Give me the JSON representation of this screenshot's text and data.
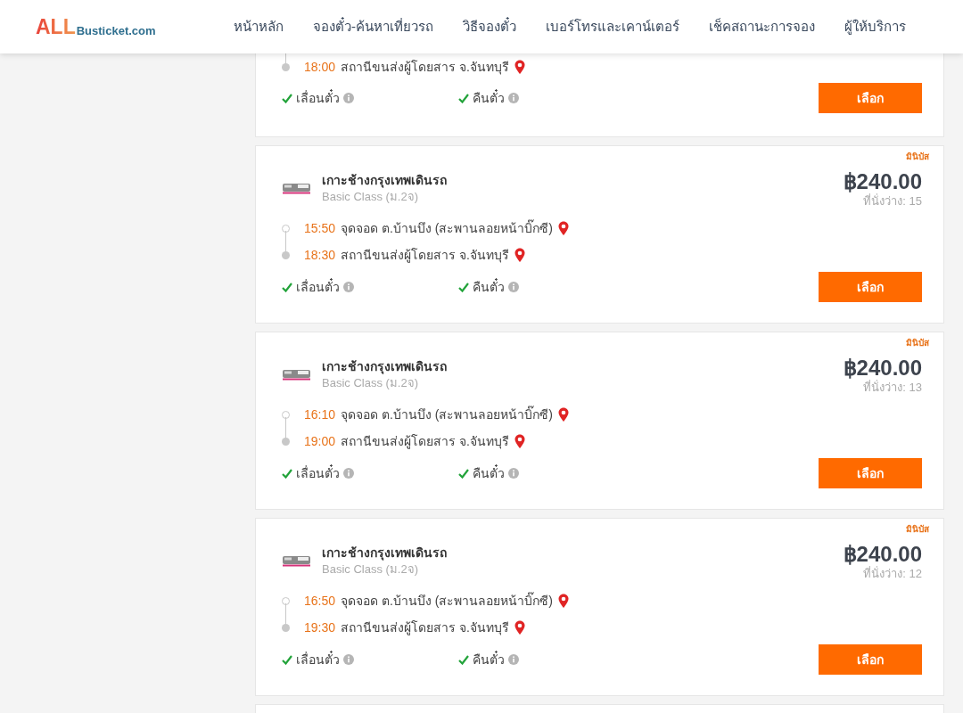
{
  "header": {
    "logo": {
      "mark": "ALL",
      "name": "Busticket.com"
    },
    "nav": [
      {
        "label": "หน้าหลัก"
      },
      {
        "label": "จองตั๋ว-ค้นหาเที่ยวรถ"
      },
      {
        "label": "วิธีจองตั๋ว"
      },
      {
        "label": "เบอร์โทรและเคาน์เตอร์"
      },
      {
        "label": "เช็คสถานะการจอง"
      },
      {
        "label": "ผู้ให้บริการ"
      }
    ]
  },
  "trips": [
    {
      "stops": [
        {
          "kind": "arrival",
          "time": "18:00",
          "place": "สถานีขนส่งผู้โดยสาร จ.จันทบุรี"
        }
      ],
      "features": [
        {
          "label": "เลื่อนตั๋ว",
          "available": true
        },
        {
          "label": "คืนตั๋ว",
          "available": true
        }
      ],
      "button": "เลือก"
    },
    {
      "badge": "มินิบัส",
      "operator": "เกาะช้างกรุงเทพเดินรถ",
      "class": "Basic Class (ม.2จ)",
      "price": "฿240.00",
      "seats": "ที่นั่งว่าง: 15",
      "stops": [
        {
          "kind": "departure",
          "time": "15:50",
          "place": "จุดจอด ต.บ้านบึง (สะพานลอยหน้าบิ๊กซี)"
        },
        {
          "kind": "arrival",
          "time": "18:30",
          "place": "สถานีขนส่งผู้โดยสาร จ.จันทบุรี"
        }
      ],
      "features": [
        {
          "label": "เลื่อนตั๋ว",
          "available": true
        },
        {
          "label": "คืนตั๋ว",
          "available": true
        }
      ],
      "button": "เลือก"
    },
    {
      "badge": "มินิบัส",
      "operator": "เกาะช้างกรุงเทพเดินรถ",
      "class": "Basic Class (ม.2จ)",
      "price": "฿240.00",
      "seats": "ที่นั่งว่าง: 13",
      "stops": [
        {
          "kind": "departure",
          "time": "16:10",
          "place": "จุดจอด ต.บ้านบึง (สะพานลอยหน้าบิ๊กซี)"
        },
        {
          "kind": "arrival",
          "time": "19:00",
          "place": "สถานีขนส่งผู้โดยสาร จ.จันทบุรี"
        }
      ],
      "features": [
        {
          "label": "เลื่อนตั๋ว",
          "available": true
        },
        {
          "label": "คืนตั๋ว",
          "available": true
        }
      ],
      "button": "เลือก"
    },
    {
      "badge": "มินิบัส",
      "operator": "เกาะช้างกรุงเทพเดินรถ",
      "class": "Basic Class (ม.2จ)",
      "price": "฿240.00",
      "seats": "ที่นั่งว่าง: 12",
      "stops": [
        {
          "kind": "departure",
          "time": "16:50",
          "place": "จุดจอด ต.บ้านบึง (สะพานลอยหน้าบิ๊กซี)"
        },
        {
          "kind": "arrival",
          "time": "19:30",
          "place": "สถานีขนส่งผู้โดยสาร จ.จันทบุรี"
        }
      ],
      "features": [
        {
          "label": "เลื่อนตั๋ว",
          "available": true
        },
        {
          "label": "คืนตั๋ว",
          "available": true
        }
      ],
      "button": "เลือก"
    }
  ]
}
